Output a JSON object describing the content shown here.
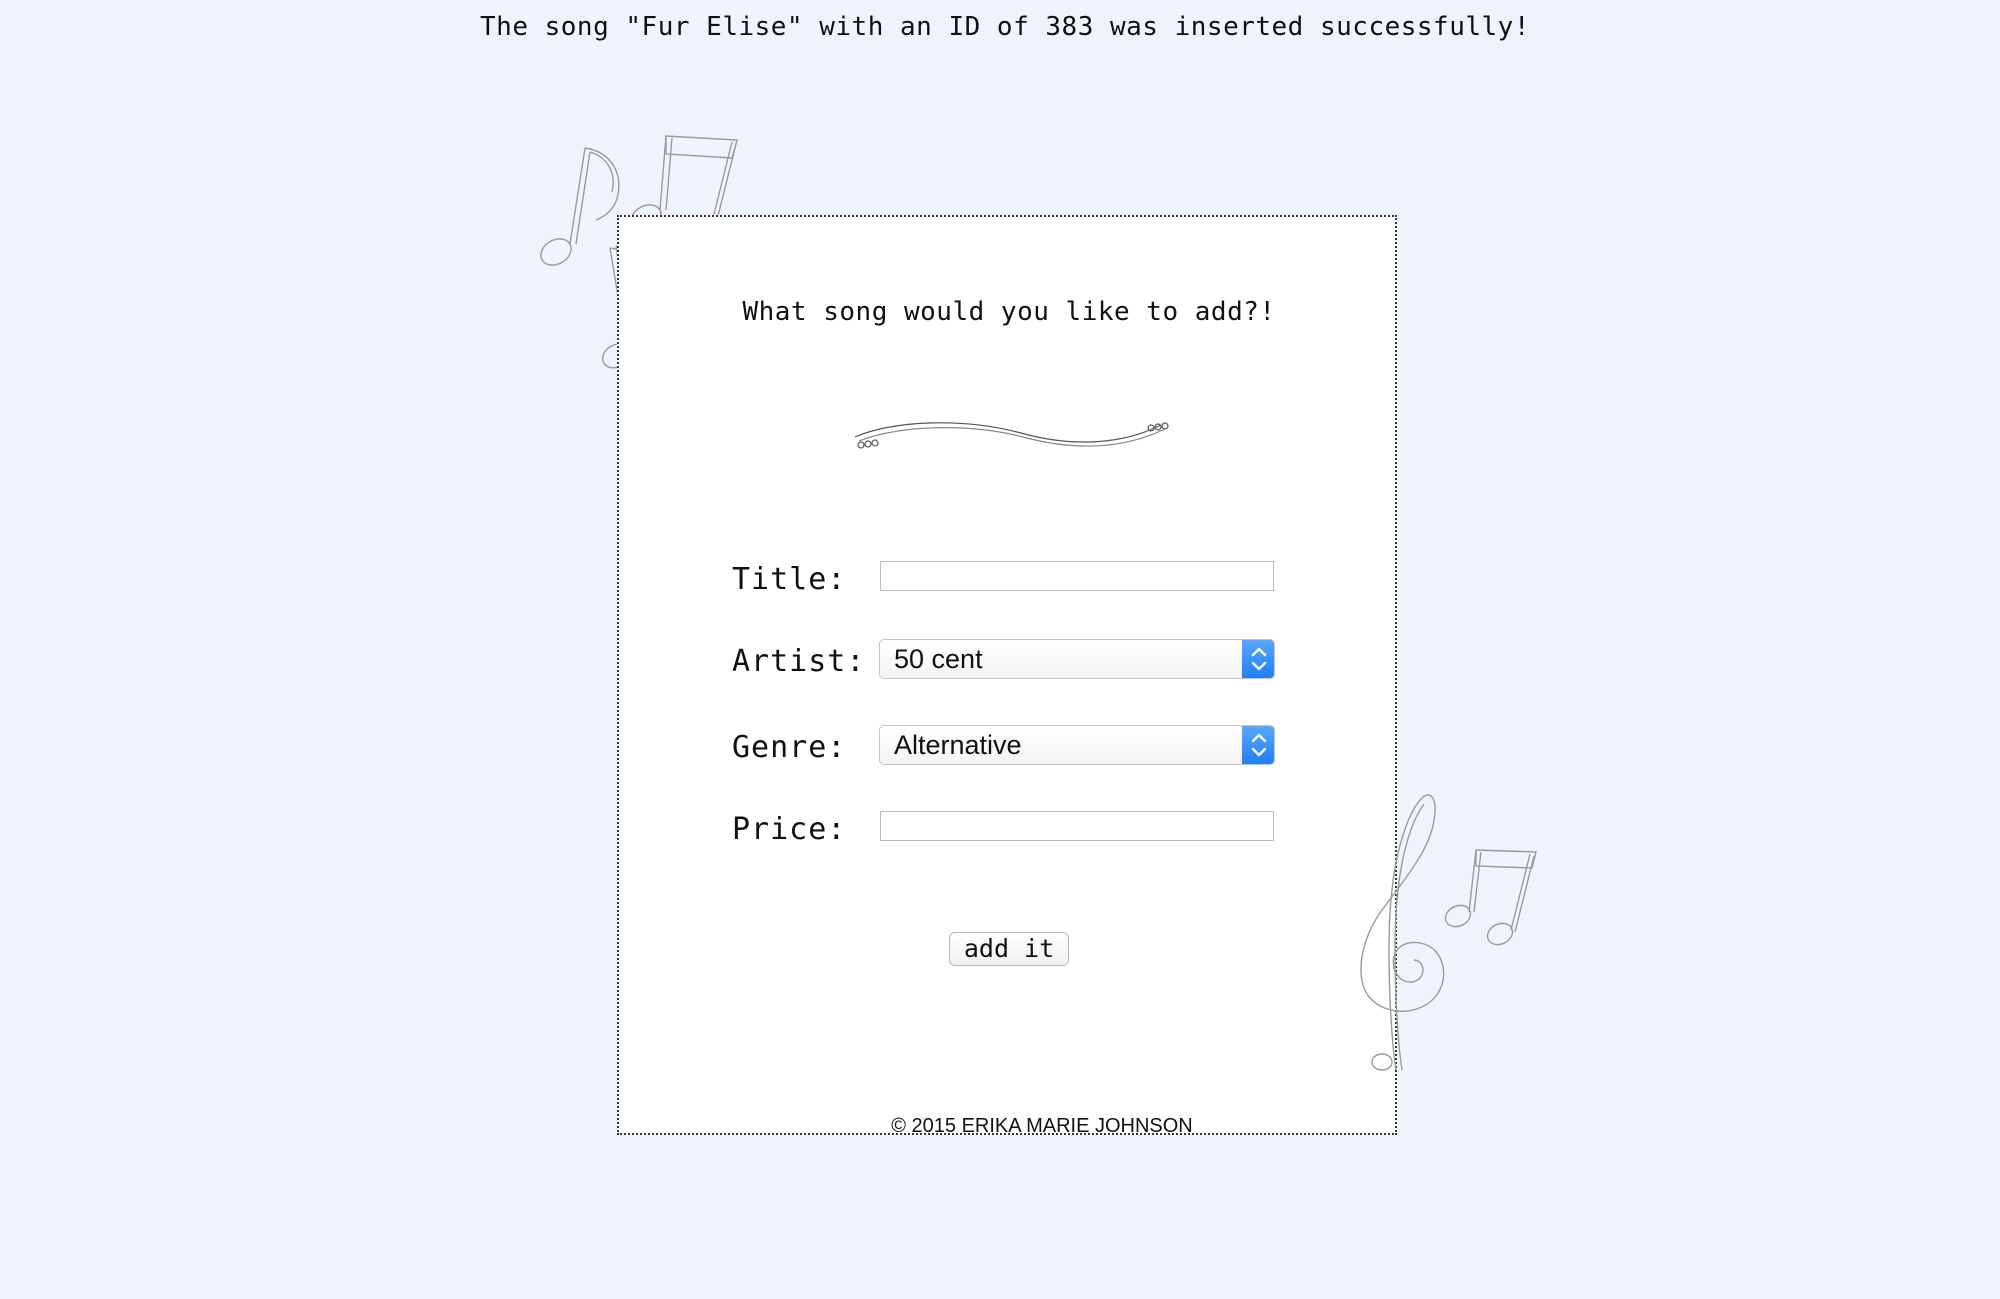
{
  "status": {
    "message": "The song \"Fur Elise\" with an ID of 383 was inserted successfully!"
  },
  "form": {
    "heading": "What song would you like to add?!",
    "fields": {
      "title": {
        "label": "Title:",
        "value": ""
      },
      "artist": {
        "label": "Artist:",
        "selected": "50 cent"
      },
      "genre": {
        "label": "Genre:",
        "selected": "Alternative"
      },
      "price": {
        "label": "Price:",
        "value": ""
      }
    },
    "submit_label": "add it"
  },
  "footer": {
    "copyright": "© 2015 ERIKA MARIE JOHNSON"
  },
  "icons": {
    "decorations": [
      "music-notes-icon",
      "wavy-divider-icon",
      "treble-clef-icon",
      "chevron-updown-icon"
    ]
  },
  "colors": {
    "page_background": "#eff4fc",
    "card_background": "#ffffff",
    "select_accent": "#1f7ef5",
    "sketch_stroke": "#9a9a9a"
  }
}
